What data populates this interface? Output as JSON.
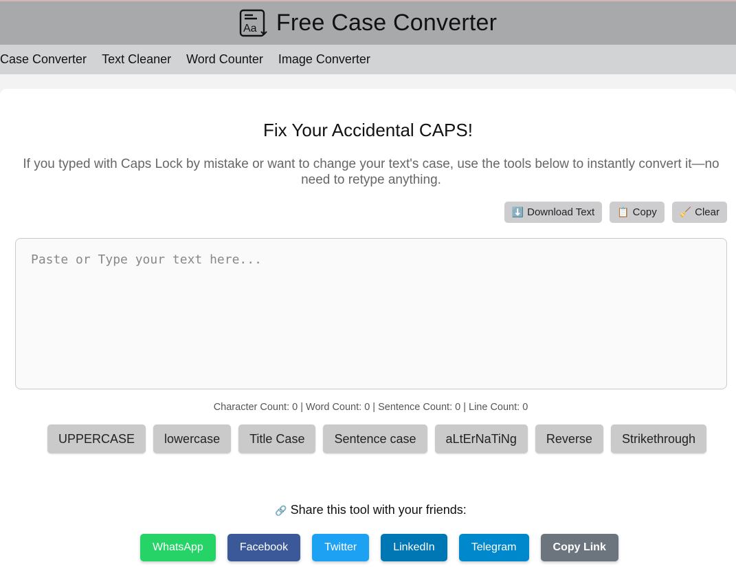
{
  "header": {
    "title": "Free Case Converter",
    "logo_icon": "text-case-icon"
  },
  "nav": {
    "items": [
      "Case Converter",
      "Text Cleaner",
      "Word Counter",
      "Image Converter"
    ]
  },
  "main": {
    "heading": "Fix Your Accidental CAPS!",
    "subtitle": "If you typed with Caps Lock by mistake or want to change your text's case, use the tools below to instantly convert it—no need to retype anything.",
    "toolbar": {
      "download": {
        "icon": "⬇️",
        "label": "Download Text"
      },
      "copy": {
        "icon": "📋",
        "label": "Copy"
      },
      "clear": {
        "icon": "🧹",
        "label": "Clear"
      }
    },
    "editor": {
      "placeholder": "Paste or Type your text here...",
      "value": ""
    },
    "counts": "Character Count: 0 | Word Count: 0 | Sentence Count: 0 | Line Count: 0",
    "case_buttons": [
      "UPPERCASE",
      "lowercase",
      "Title Case",
      "Sentence case",
      "aLtErNaTiNg",
      "Reverse",
      "Strikethrough"
    ],
    "share": {
      "icon": "🔗",
      "label": "Share this tool with your friends:",
      "buttons": [
        {
          "label": "WhatsApp",
          "color": "#25d366"
        },
        {
          "label": "Facebook",
          "color": "#3b5998"
        },
        {
          "label": "Twitter",
          "color": "#1da1f2"
        },
        {
          "label": "LinkedIn",
          "color": "#0077b5"
        },
        {
          "label": "Telegram",
          "color": "#0088cc"
        },
        {
          "label": "Copy Link",
          "color": "#6c757d"
        }
      ]
    }
  }
}
